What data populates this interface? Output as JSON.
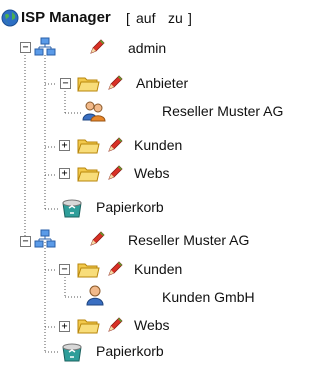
{
  "header": {
    "title": "ISP Manager",
    "links_open": "[",
    "auf": "auf",
    "zu": "zu",
    "links_close": "]"
  },
  "tree": {
    "admin": {
      "label": "admin",
      "toggle": "−",
      "anbieter": {
        "label": "Anbieter",
        "toggle": "−"
      },
      "reseller_user": {
        "label": "Reseller Muster AG"
      },
      "kunden": {
        "label": "Kunden",
        "toggle": "+"
      },
      "webs": {
        "label": "Webs",
        "toggle": "+"
      },
      "papierkorb": {
        "label": "Papierkorb"
      }
    },
    "reseller": {
      "label": "Reseller Muster AG",
      "toggle": "−",
      "kunden": {
        "label": "Kunden",
        "toggle": "−"
      },
      "kunden_gmbh": {
        "label": "Kunden GmbH"
      },
      "webs": {
        "label": "Webs",
        "toggle": "+"
      },
      "papierkorb": {
        "label": "Papierkorb"
      }
    }
  },
  "icons": {
    "globe": "globe-icon",
    "network": "network-icon",
    "edit": "pencil-edit-icon",
    "folder": "folder-icon",
    "group": "user-group-icon",
    "user": "user-icon",
    "trash": "recycle-bin-icon"
  },
  "colors": {
    "folder": "#f2c94c",
    "pencil": "#d93025",
    "network": "#3b7dd8",
    "bin": "#2e9e9a"
  }
}
